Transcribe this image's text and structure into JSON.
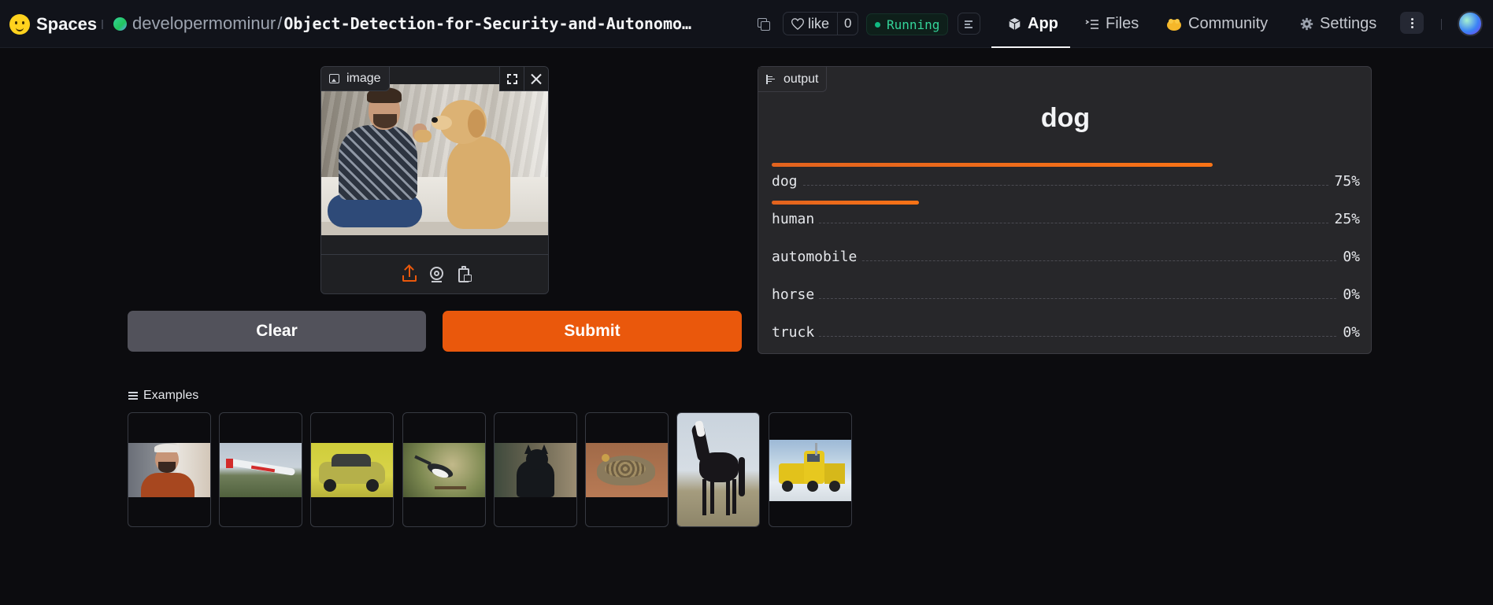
{
  "header": {
    "brand": "Spaces",
    "owner": "developermominur",
    "separator": "/",
    "repo_name": "Object-Detection-for-Security-and-Autonomo…",
    "like_label": "like",
    "like_count": "0",
    "status": "Running",
    "nav": [
      {
        "label": "App",
        "icon": "cube-icon"
      },
      {
        "label": "Files",
        "icon": "files-icon"
      },
      {
        "label": "Community",
        "icon": "hands-icon"
      },
      {
        "label": "Settings",
        "icon": "gear-icon"
      }
    ]
  },
  "input": {
    "label": "image",
    "image_subject": "man high-fiving a golden retriever"
  },
  "buttons": {
    "clear": "Clear",
    "submit": "Submit"
  },
  "output": {
    "label": "output",
    "prediction": "dog",
    "confidences": [
      {
        "label": "dog",
        "value": "75%",
        "fraction": 0.75
      },
      {
        "label": "human",
        "value": "25%",
        "fraction": 0.25
      },
      {
        "label": "automobile",
        "value": "0%",
        "fraction": 0
      },
      {
        "label": "horse",
        "value": "0%",
        "fraction": 0
      },
      {
        "label": "truck",
        "value": "0%",
        "fraction": 0
      }
    ]
  },
  "examples": {
    "title": "Examples",
    "items": [
      "person",
      "airplane",
      "car",
      "bird",
      "cat",
      "frog",
      "horse",
      "truck"
    ]
  },
  "colors": {
    "accent": "#ea580c",
    "clear_button": "#52525b",
    "status_green": "#34d399"
  }
}
